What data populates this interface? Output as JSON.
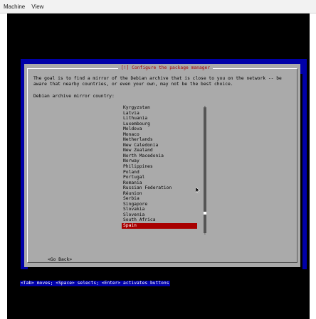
{
  "menubar": {
    "items": [
      "Machine",
      "View"
    ]
  },
  "dialog": {
    "title": "[!] Configure the package manager",
    "description": "The goal is to find a mirror of the Debian archive that is close to you on the network -- be aware that nearby countries, or even your own, may not be the best choice.",
    "prompt": "Debian archive mirror country:",
    "countries": [
      "Kyrgyzstan",
      "Latvia",
      "Lithuania",
      "Luxembourg",
      "Moldova",
      "Monaco",
      "Netherlands",
      "New Caledonia",
      "New Zealand",
      "North Macedonia",
      "Norway",
      "Philippines",
      "Poland",
      "Portugal",
      "Romania",
      "Russian Federation",
      "Réunion",
      "Serbia",
      "Singapore",
      "Slovakia",
      "Slovenia",
      "South Africa",
      "Spain"
    ],
    "selected": "Spain",
    "go_back": "<Go Back>"
  },
  "statusbar": {
    "text": "<Tab> moves; <Space> selects; <Enter> activates buttons"
  },
  "colors": {
    "background": "#0000a8",
    "dialog": "#aaaaaa",
    "title": "#a80000",
    "selection": "#a80000"
  }
}
